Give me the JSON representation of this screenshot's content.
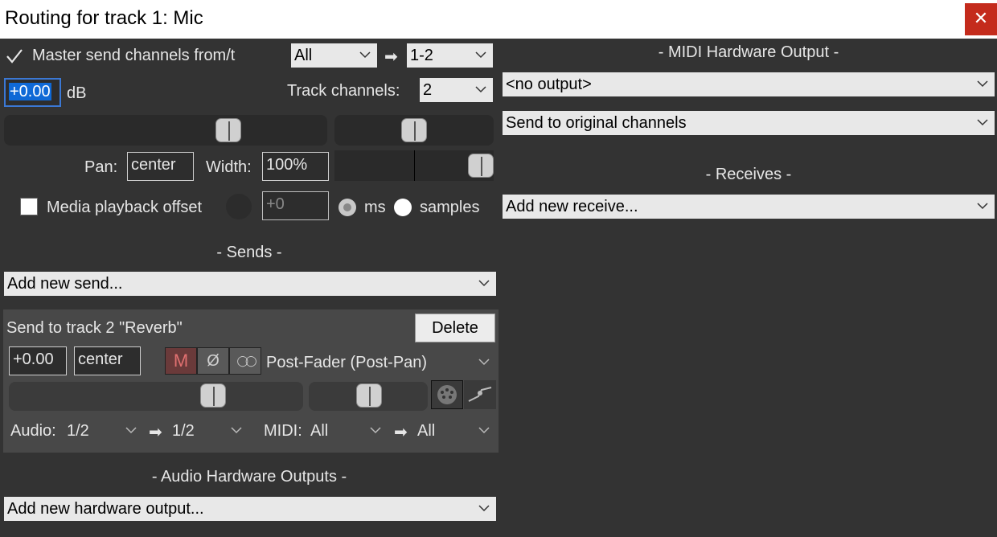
{
  "window": {
    "title": "Routing for track 1: Mic",
    "close_glyph": "✕"
  },
  "master": {
    "checkbox_label": "Master send channels from/t",
    "checked": true,
    "from_value": "All",
    "arrow": "➡",
    "to_value": "1-2",
    "db_value": "+0.00",
    "db_unit": "dB",
    "track_channels_label": "Track channels:",
    "track_channels_value": "2",
    "pan_label": "Pan:",
    "pan_value": "center",
    "width_label": "Width:",
    "width_value": "100%"
  },
  "media_offset": {
    "checkbox_label": "Media playback offset",
    "checked": false,
    "value": "+0",
    "ms_label": "ms",
    "samples_label": "samples"
  },
  "sends": {
    "header": "-  Sends  -",
    "add_new": "Add new send...",
    "item": {
      "title": "Send to track 2 \"Reverb\"",
      "delete_label": "Delete",
      "volume": "+0.00",
      "pan": "center",
      "mute_glyph": "M",
      "phase_glyph": "Ø",
      "mono_glyph": "◯◯",
      "mode": "Post-Fader (Post-Pan)",
      "audio_label": "Audio:",
      "audio_src": "1/2",
      "audio_arrow": "➡",
      "audio_dst": "1/2",
      "midi_label": "MIDI:",
      "midi_src": "All",
      "midi_arrow": "➡",
      "midi_dst": "All"
    }
  },
  "audio_hw": {
    "header": "-  Audio Hardware Outputs  -",
    "add_new": "Add new hardware output..."
  },
  "midi_hw": {
    "header": "-  MIDI Hardware Output  -",
    "output": "<no output>",
    "channels": "Send to original channels"
  },
  "receives": {
    "header": "-  Receives  -",
    "add_new": "Add new receive..."
  },
  "colors": {
    "close_bg": "#c42b1c",
    "bg": "#333333",
    "selection": "#0f69d6",
    "mute": "#a33a3a"
  }
}
